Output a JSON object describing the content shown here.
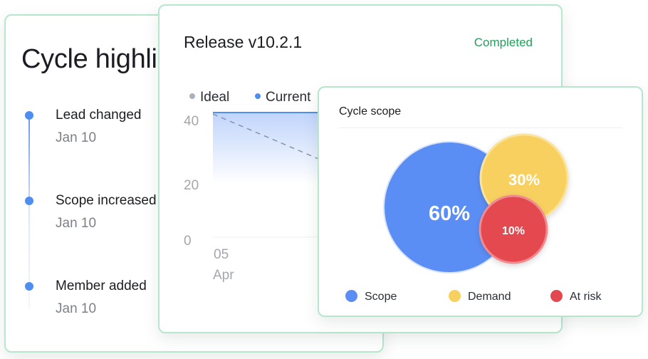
{
  "highlights": {
    "title": "Cycle highlights",
    "items": [
      {
        "title": "Lead changed",
        "date": "Jan 10"
      },
      {
        "title": "Scope increased",
        "date": "Jan 10"
      },
      {
        "title": "Member added",
        "date": "Jan 10"
      }
    ]
  },
  "release": {
    "title": "Release v10.2.1",
    "status": "Completed",
    "legend": {
      "ideal": "Ideal",
      "current": "Current"
    },
    "y_ticks": [
      "40",
      "20",
      "0"
    ],
    "x_tick": {
      "day": "05",
      "month": "Apr"
    }
  },
  "scope": {
    "title": "Cycle scope",
    "segments": [
      {
        "label": "Scope",
        "value": 60,
        "display": "60%",
        "color": "#5b8ef5"
      },
      {
        "label": "Demand",
        "value": 30,
        "display": "30%",
        "color": "#f8d060"
      },
      {
        "label": "At risk",
        "value": 10,
        "display": "10%",
        "color": "#e4484f"
      }
    ]
  },
  "colors": {
    "accent_green": "#21a05a",
    "card_border": "#b7e6cf",
    "blue": "#4e8ef0",
    "ideal_gray": "#a9b1bd"
  }
}
